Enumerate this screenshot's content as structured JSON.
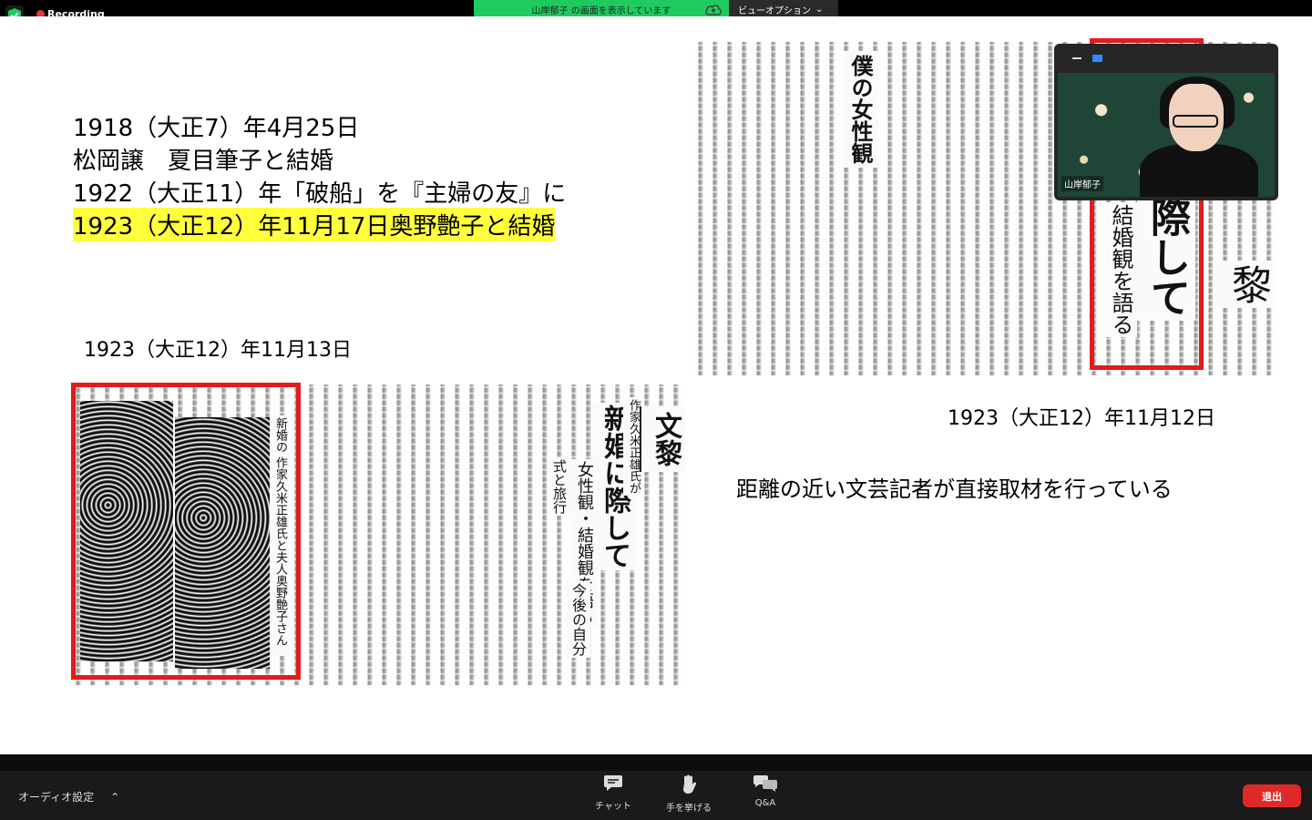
{
  "recording": {
    "label": "Recording"
  },
  "share_banner": {
    "text": "山岸郁子 の画面を表示しています"
  },
  "view_options": {
    "label": "ビューオプション"
  },
  "slide": {
    "line1": "1918（大正7）年4月25日",
    "line2": "松岡譲　夏目筆子と結婚",
    "line3": "1922（大正11）年「破船」を『主婦の友』に",
    "line4": "1923（大正12）年11月17日奥野艶子と結婚",
    "caption_left": "1923（大正12）年11月13日",
    "caption_right": "1923（大正12）年11月12日",
    "note": "距離の近い文芸記者が直接取材を行っている",
    "clip_top": {
      "heading": "僕の女性観",
      "title": "際して",
      "subtitle": "結婚観を語る",
      "section": "黎"
    },
    "clip_bottom": {
      "heading": "新婚に際して",
      "author": "作家久米正雄氏が",
      "subtitle": "女性観・結婚観を語る",
      "section": "文黎",
      "photo_caption": "新婚の 作家久米正雄氏と夫人奥野艶子さん",
      "sub_heading": "今後の自分",
      "sub2": "式と旅行"
    }
  },
  "video": {
    "name": "山岸郁子"
  },
  "bottombar": {
    "audio_label": "オーディオ設定",
    "chat_label": "チャット",
    "raise_hand_label": "手を挙げる",
    "qa_label": "Q&A",
    "leave_label": "退出"
  },
  "colors": {
    "highlight": "#ffff3b",
    "red_box": "#e31b1b",
    "share_green": "#1fcb5f",
    "leave_red": "#e02828",
    "accent_blue": "#2d8cff"
  }
}
